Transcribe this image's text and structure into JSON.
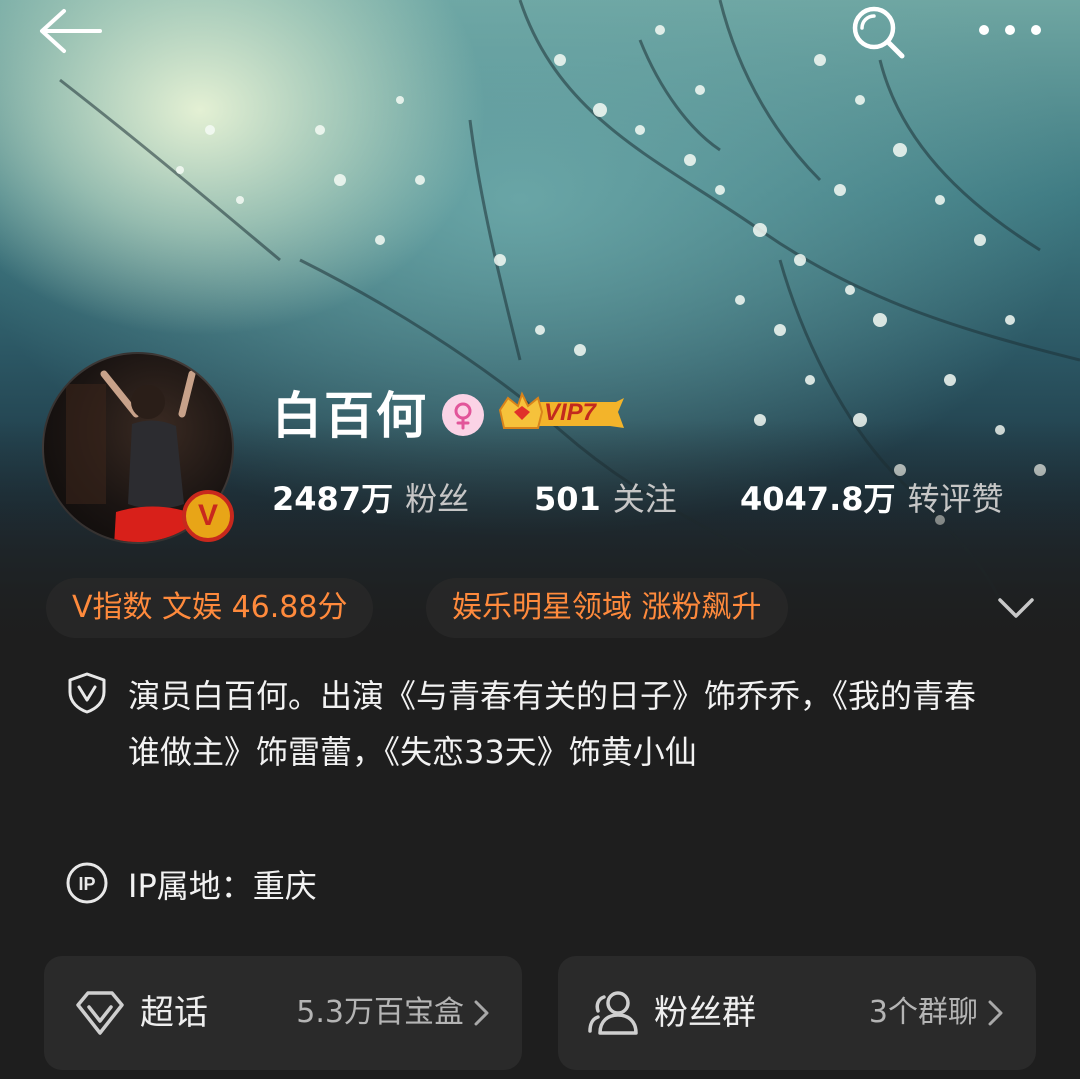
{
  "profile": {
    "name": "白百何",
    "vip_label": "VIP7",
    "verified_mark": "V"
  },
  "stats": [
    {
      "value": "2487万",
      "label": "粉丝"
    },
    {
      "value": "501",
      "label": "关注"
    },
    {
      "value": "4047.8万",
      "label": "转评赞"
    }
  ],
  "tags": [
    {
      "text": "V指数 文娱 46.88分"
    },
    {
      "text": "娱乐明星领域 涨粉飙升"
    }
  ],
  "bio": {
    "text": "演员白百何。出演《与青春有关的日子》饰乔乔，《我的青春谁做主》饰雷蕾，《失恋33天》饰黄小仙"
  },
  "ip": {
    "text": "IP属地：重庆"
  },
  "cards": [
    {
      "title": "超话",
      "meta": "5.3万百宝盒",
      "icon": "diamond-icon"
    },
    {
      "title": "粉丝群",
      "meta": "3个群聊",
      "icon": "group-icon"
    }
  ],
  "icons": {
    "back": "back-arrow-icon",
    "search": "search-icon",
    "more": "more-dots-icon",
    "gender": "female-icon",
    "vip": "vip-crown-icon",
    "expand": "chevron-down-icon",
    "verified": "shield-v-icon",
    "ip": "ip-icon"
  },
  "colors": {
    "background": "#1e1e1e",
    "tag_text": "#ff8a3c",
    "vip_gold": "#f0a21c",
    "verified_badge": "#e8a517",
    "gender_pink": "#fbd3e6"
  }
}
